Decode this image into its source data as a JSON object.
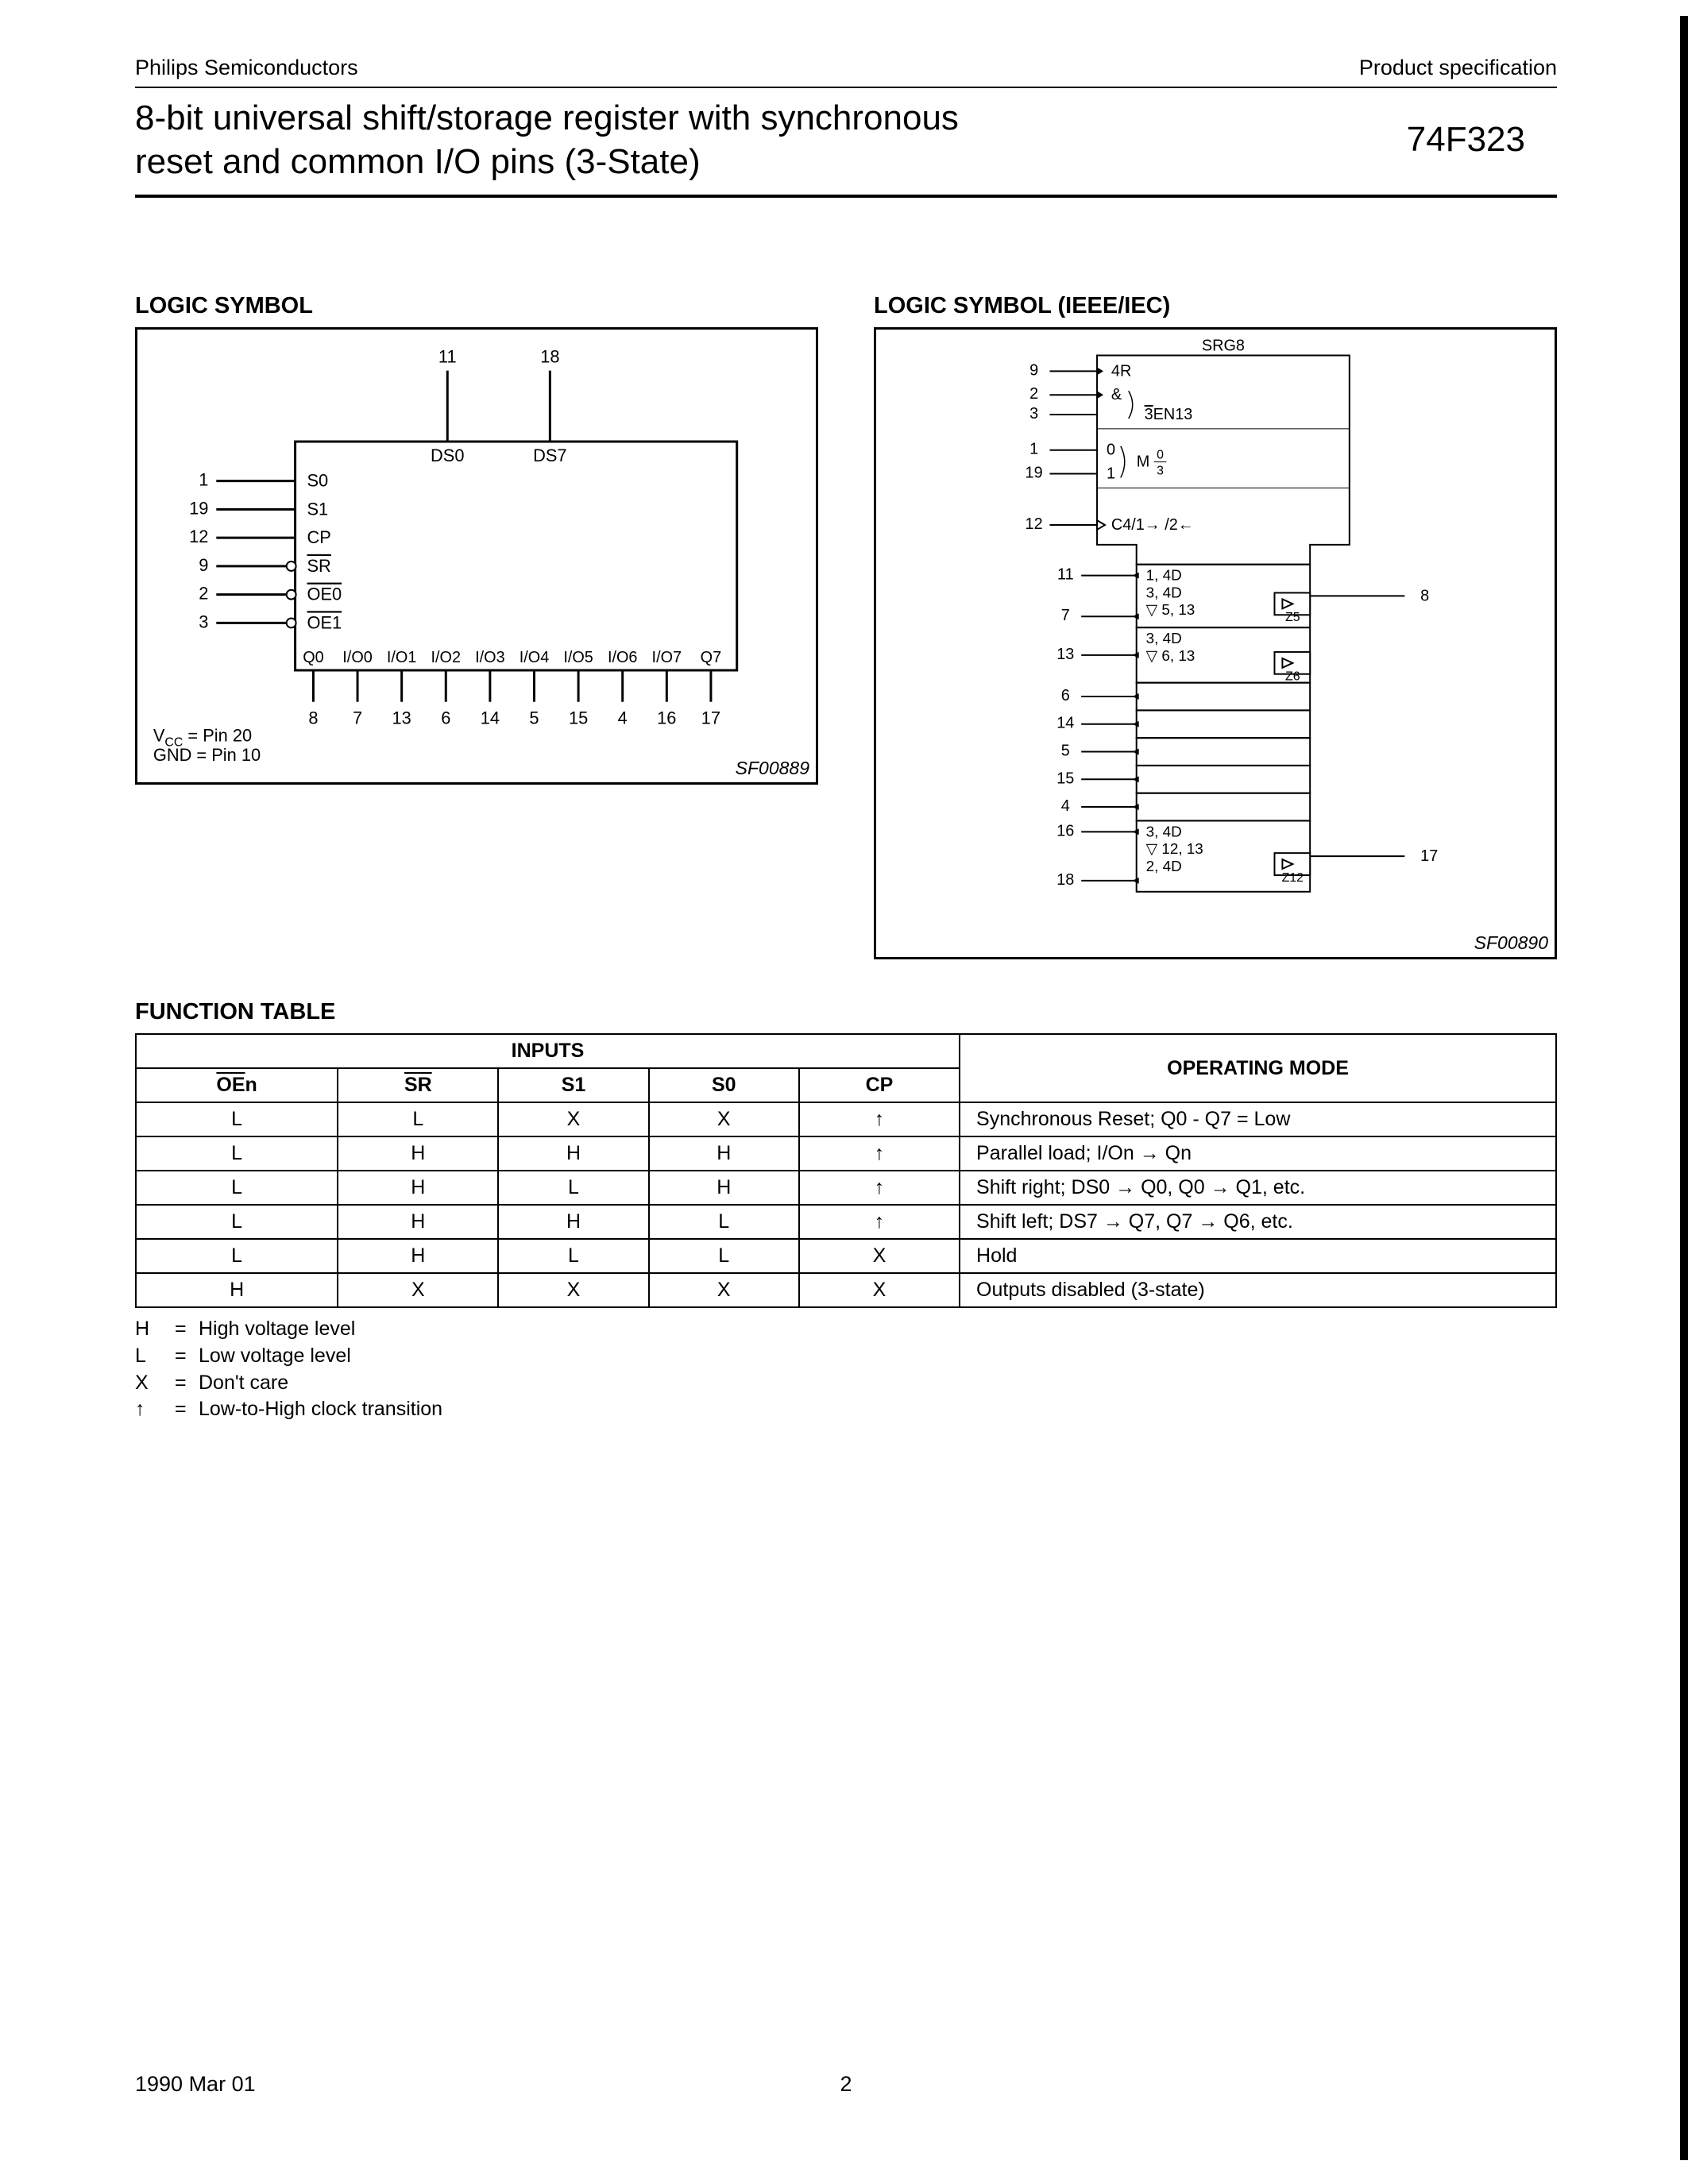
{
  "header": {
    "company": "Philips Semiconductors",
    "doc_type": "Product specification",
    "title_line1": "8-bit universal shift/storage register with synchronous",
    "title_line2": "reset and common I/O pins (3-State)",
    "part_number": "74F323"
  },
  "sections": {
    "logic_symbol": "LOGIC SYMBOL",
    "logic_symbol_ieee": "LOGIC SYMBOL (IEEE/IEC)",
    "function_table": "FUNCTION TABLE"
  },
  "logic_symbol": {
    "top_pins": [
      {
        "num": "11",
        "label": "DS0"
      },
      {
        "num": "18",
        "label": "DS7"
      }
    ],
    "left_pins": [
      {
        "num": "1",
        "label": "S0",
        "inv": false
      },
      {
        "num": "19",
        "label": "S1",
        "inv": false
      },
      {
        "num": "12",
        "label": "CP",
        "inv": false
      },
      {
        "num": "9",
        "label": "SR",
        "inv": true,
        "overline": true
      },
      {
        "num": "2",
        "label": "OE0",
        "inv": true,
        "overline": true
      },
      {
        "num": "3",
        "label": "OE1",
        "inv": true,
        "overline": true
      }
    ],
    "bottom_labels": [
      "Q0",
      "I/O0",
      "I/O1",
      "I/O2",
      "I/O3",
      "I/O4",
      "I/O5",
      "I/O6",
      "I/O7",
      "Q7"
    ],
    "bottom_pins": [
      "8",
      "7",
      "13",
      "6",
      "14",
      "5",
      "15",
      "4",
      "16",
      "17"
    ],
    "notes": {
      "vcc": "V",
      "vcc_sub": "CC",
      "vcc_rest": " = Pin 20",
      "gnd": "GND = Pin 10"
    },
    "sf": "SF00889"
  },
  "ieee_symbol": {
    "header": "SRG8",
    "ctrl": {
      "r1": {
        "pin": "9",
        "label": "4R"
      },
      "r2": {
        "pin": "2",
        "label": "&"
      },
      "r3": {
        "pin": "3",
        "label": "3EN13",
        "overline": "3"
      },
      "r4": {
        "pin": "1",
        "label_l": "0",
        "label_r": "M"
      },
      "r5": {
        "pin": "19",
        "label_l": "1",
        "label_r": "0–3",
        "frac_top": "0",
        "frac_bot": "3"
      },
      "r6": {
        "pin": "12",
        "label": "C4/1→ /2←"
      }
    },
    "cells": [
      {
        "left_pins": [
          "11",
          "7"
        ],
        "right_pin": "8",
        "labels": [
          "1, 4D",
          "3, 4D",
          "▽ 5, 13"
        ],
        "z": "Z5"
      },
      {
        "left_pins": [
          "13"
        ],
        "right_pin": "",
        "labels": [
          "3, 4D",
          "▽ 6, 13"
        ],
        "z": "Z6"
      },
      {
        "left_pins": [
          "6"
        ],
        "right_pin": "",
        "labels": []
      },
      {
        "left_pins": [
          "14"
        ],
        "right_pin": "",
        "labels": []
      },
      {
        "left_pins": [
          "5"
        ],
        "right_pin": "",
        "labels": []
      },
      {
        "left_pins": [
          "15"
        ],
        "right_pin": "",
        "labels": []
      },
      {
        "left_pins": [
          "4"
        ],
        "right_pin": "",
        "labels": []
      },
      {
        "left_pins": [
          "16",
          "18"
        ],
        "right_pin": "17",
        "labels": [
          "3, 4D",
          "▽ 12, 13",
          "2, 4D"
        ],
        "z": "Z12"
      }
    ],
    "sf": "SF00890"
  },
  "function_table": {
    "headers": {
      "inputs": "INPUTS",
      "mode": "OPERATING MODE",
      "cols": [
        "OEn",
        "SR",
        "S1",
        "S0",
        "CP"
      ]
    },
    "rows": [
      {
        "c": [
          "L",
          "L",
          "X",
          "X",
          "↑"
        ],
        "mode": "Synchronous Reset; Q0 - Q7 = Low"
      },
      {
        "c": [
          "L",
          "H",
          "H",
          "H",
          "↑"
        ],
        "mode": "Parallel load; I/On → Qn"
      },
      {
        "c": [
          "L",
          "H",
          "L",
          "H",
          "↑"
        ],
        "mode": "Shift right; DS0 → Q0, Q0 → Q1, etc."
      },
      {
        "c": [
          "L",
          "H",
          "H",
          "L",
          "↑"
        ],
        "mode": "Shift left; DS7  → Q7, Q7  → Q6, etc."
      },
      {
        "c": [
          "L",
          "H",
          "L",
          "L",
          "X"
        ],
        "mode": "Hold"
      },
      {
        "c": [
          "H",
          "X",
          "X",
          "X",
          "X"
        ],
        "mode": "Outputs disabled (3-state)"
      }
    ],
    "legend": [
      {
        "sym": "H",
        "desc": "High voltage level"
      },
      {
        "sym": "L",
        "desc": "Low voltage level"
      },
      {
        "sym": "X",
        "desc": "Don't care"
      },
      {
        "sym": "↑",
        "desc": "Low-to-High clock transition"
      }
    ]
  },
  "footer": {
    "date": "1990 Mar 01",
    "page": "2"
  }
}
